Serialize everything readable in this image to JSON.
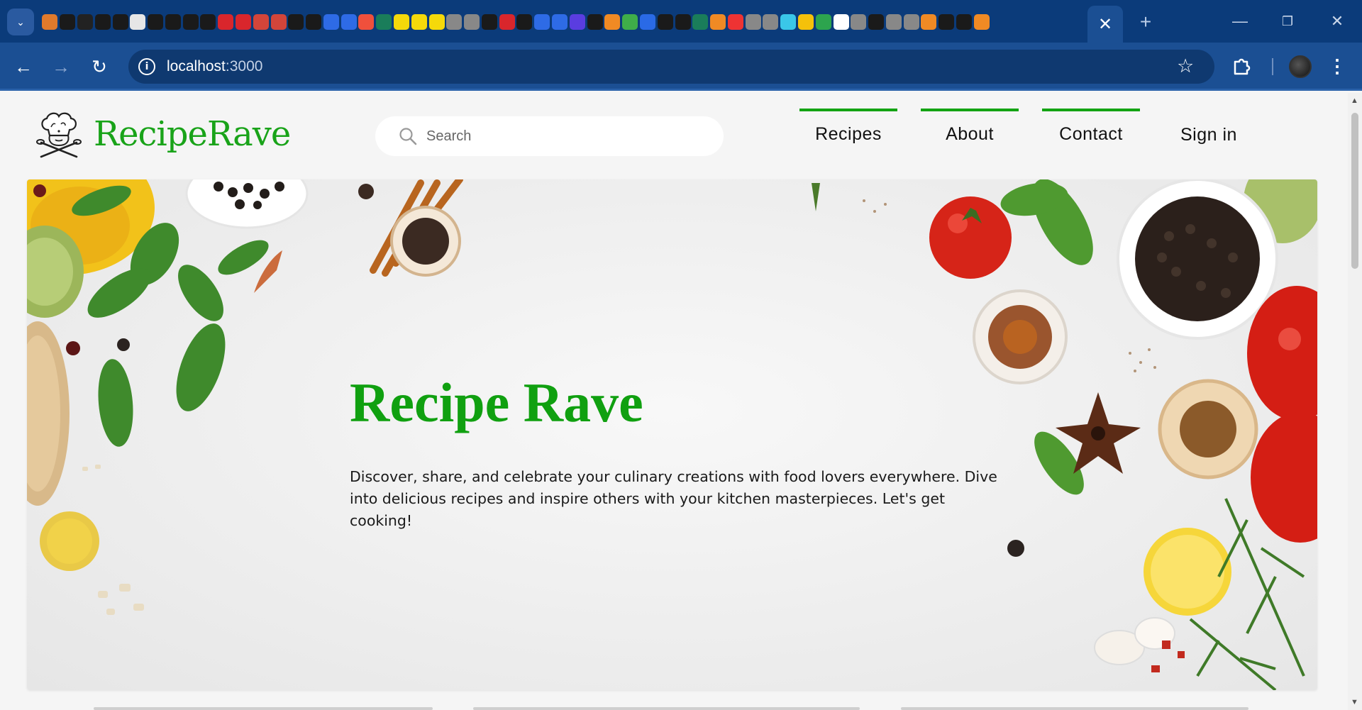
{
  "browser": {
    "address": {
      "host": "localhost",
      "port": ":3000"
    },
    "favicon_colors": [
      "#e07a2c",
      "#1a1a1a",
      "#222",
      "#1a1a1a",
      "#1a1a1a",
      "#e6e6e6",
      "#1a1a1a",
      "#1a1a1a",
      "#1a1a1a",
      "#1a1a1a",
      "#d9262c",
      "#d9262c",
      "#d3453a",
      "#d3453a",
      "#1a1a1a",
      "#1a1a1a",
      "#2e6be6",
      "#2e6be6",
      "#f0503c",
      "#1a7d5a",
      "#f5d90a",
      "#f5d90a",
      "#f5d90a",
      "#888",
      "#888",
      "#1a1a1a",
      "#d9262c",
      "#1a1a1a",
      "#2e6be6",
      "#2e6be6",
      "#5a3de0",
      "#1a1a1a",
      "#f08a24",
      "#3fae49",
      "#2a6ae6",
      "#1a1a1a",
      "#1a1a1a",
      "#1a7d5a",
      "#f08a24",
      "#e33",
      "#888",
      "#888",
      "#3ac7e8",
      "#f5c10a",
      "#2da44e",
      "#ffffff",
      "#888",
      "#1a1a1a",
      "#888",
      "#888",
      "#f08a24",
      "#1a1a1a",
      "#1a1a1a",
      "#f08a24"
    ]
  },
  "site": {
    "brand": "RecipeRave",
    "search_placeholder": "Search",
    "nav": {
      "recipes": "Recipes",
      "about": "About",
      "contact": "Contact",
      "signin": "Sign in"
    }
  },
  "hero": {
    "title": "Recipe Rave",
    "text": "Discover, share, and celebrate your culinary creations with food lovers everywhere. Dive into delicious recipes and inspire others with your kitchen masterpieces. Let's get cooking!"
  },
  "colors": {
    "brand_green": "#19a319",
    "nav_accent": "#13a313",
    "chrome_dark": "#0b3b7a",
    "chrome_toolbar": "#1b4f93"
  }
}
